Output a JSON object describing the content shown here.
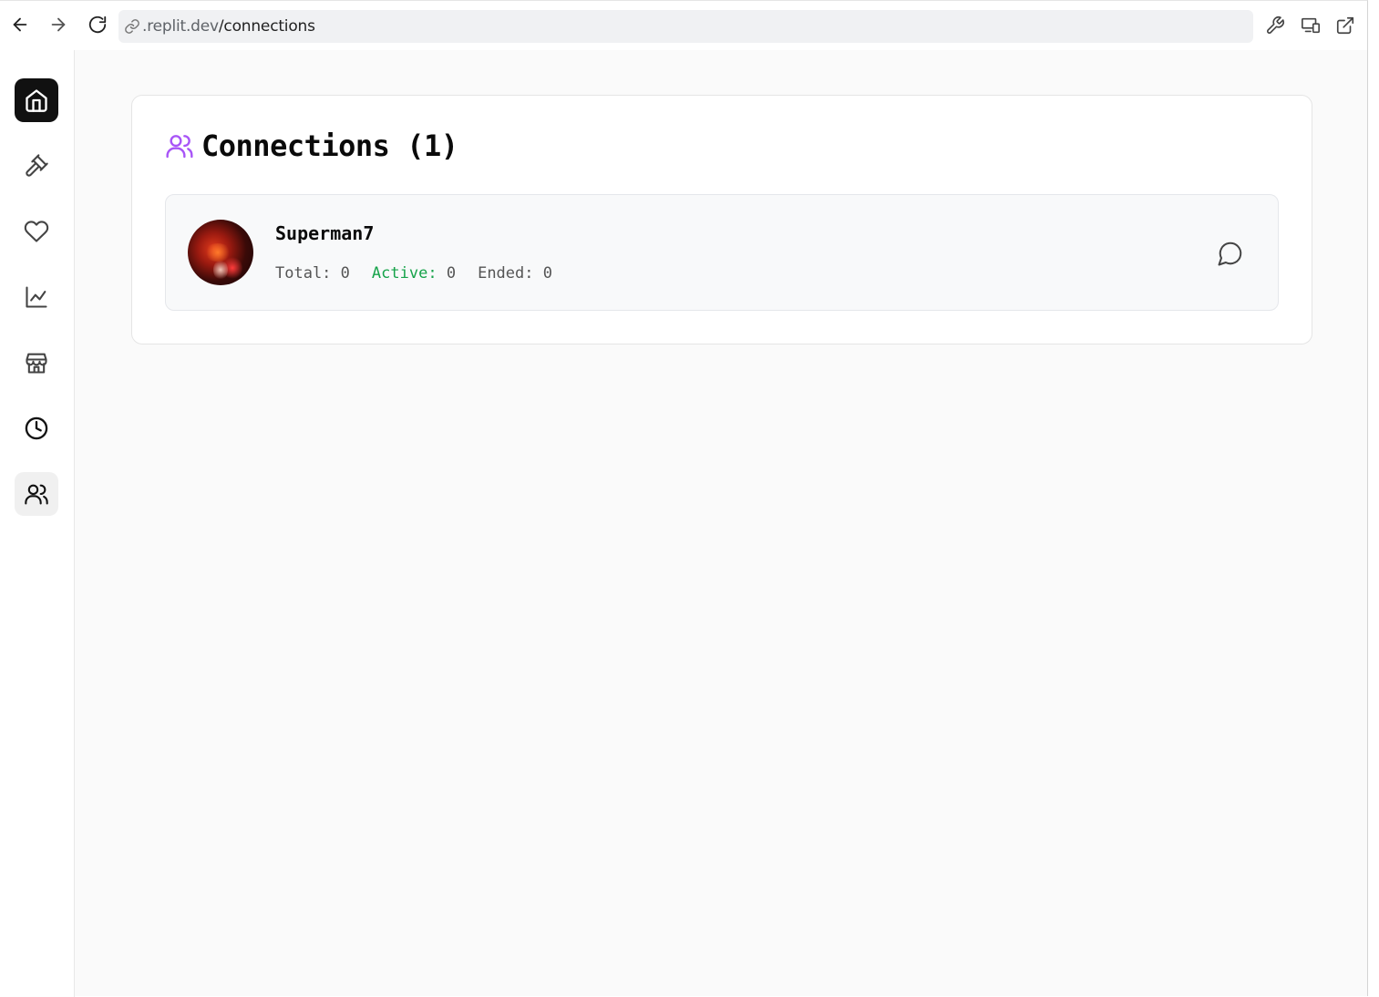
{
  "browser": {
    "url_prefix": ".replit.dev",
    "url_path": "/connections"
  },
  "sidebar": {
    "items": [
      {
        "icon": "home-icon",
        "state": "active"
      },
      {
        "icon": "gavel-icon"
      },
      {
        "icon": "heart-icon"
      },
      {
        "icon": "chart-line-icon"
      },
      {
        "icon": "store-icon"
      },
      {
        "icon": "clock-icon"
      },
      {
        "icon": "users-icon",
        "state": "selected"
      }
    ]
  },
  "page": {
    "title": "Connections (1)",
    "title_icon": "users-icon",
    "accent_color": "#a855f7"
  },
  "connections": [
    {
      "name": "Superman7",
      "total_label": "Total:",
      "total_value": "0",
      "active_label": "Active:",
      "active_value": "0",
      "ended_label": "Ended:",
      "ended_value": "0",
      "action_icon": "message-circle-icon"
    }
  ],
  "colors": {
    "active_green": "#16a34a",
    "sidebar_active_bg": "#111111"
  }
}
